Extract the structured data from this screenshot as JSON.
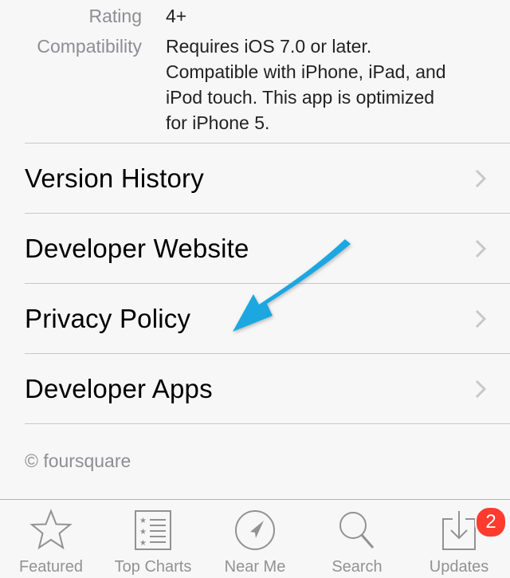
{
  "info": {
    "rating_label": "Rating",
    "rating_value": "4+",
    "compat_label": "Compatibility",
    "compat_lines": [
      "Requires iOS 7.0 or later.",
      "Compatible with iPhone, iPad, and",
      "iPod touch. This app is optimized",
      "for iPhone 5."
    ]
  },
  "links": [
    {
      "label": "Version History"
    },
    {
      "label": "Developer Website"
    },
    {
      "label": "Privacy Policy"
    },
    {
      "label": "Developer Apps"
    }
  ],
  "copyright": "© foursquare",
  "tabs": [
    {
      "label": "Featured",
      "icon": "star-icon"
    },
    {
      "label": "Top Charts",
      "icon": "list-icon"
    },
    {
      "label": "Near Me",
      "icon": "location-icon"
    },
    {
      "label": "Search",
      "icon": "search-icon"
    },
    {
      "label": "Updates",
      "icon": "download-icon"
    }
  ],
  "updates_badge": "2",
  "colors": {
    "background": "#f7f7f7",
    "separator": "#c8c7cc",
    "secondary_text": "#8e8e93",
    "badge": "#ff3b30",
    "annotation_arrow": "#1da7e0"
  }
}
